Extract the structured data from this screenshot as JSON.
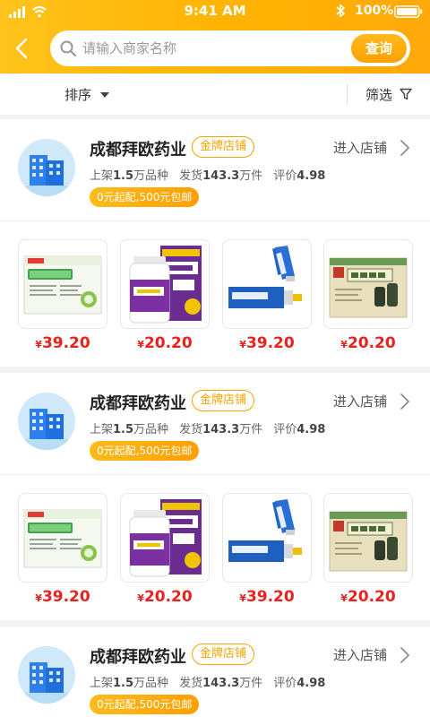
{
  "status_bar": {
    "time": "9:41 AM",
    "battery": "100%"
  },
  "search": {
    "placeholder": "请输入商家名称",
    "button_label": "查询"
  },
  "filter_bar": {
    "sort_label": "排序",
    "filter_label": "筛选"
  },
  "colors": {
    "accent": "#ffb300",
    "price": "#e8221d",
    "badge": "#f5a300"
  },
  "stores": [
    {
      "name": "成都拜欧药业",
      "badge": "金牌店铺",
      "enter_label": "进入店铺",
      "listed_label": "上架",
      "listed_value": "1.5",
      "listed_unit": "万品种",
      "shipped_label": "发货",
      "shipped_value": "143.3",
      "shipped_unit": "万件",
      "rating_label": "评价",
      "rating_value": "4.98",
      "promo": "0元起配,500元包邮",
      "products": [
        {
          "image": "green-granule-box",
          "currency": "¥",
          "price": "39.20"
        },
        {
          "image": "caltrate-bottle-box",
          "currency": "¥",
          "price": "20.20"
        },
        {
          "image": "blue-ointment-tube",
          "currency": "¥",
          "price": "39.20"
        },
        {
          "image": "huoxiang-box",
          "currency": "¥",
          "price": "20.20"
        }
      ]
    },
    {
      "name": "成都拜欧药业",
      "badge": "金牌店铺",
      "enter_label": "进入店铺",
      "listed_label": "上架",
      "listed_value": "1.5",
      "listed_unit": "万品种",
      "shipped_label": "发货",
      "shipped_value": "143.3",
      "shipped_unit": "万件",
      "rating_label": "评价",
      "rating_value": "4.98",
      "promo": "0元起配,500元包邮",
      "products": [
        {
          "image": "green-granule-box",
          "currency": "¥",
          "price": "39.20"
        },
        {
          "image": "caltrate-bottle-box",
          "currency": "¥",
          "price": "20.20"
        },
        {
          "image": "blue-ointment-tube",
          "currency": "¥",
          "price": "39.20"
        },
        {
          "image": "huoxiang-box",
          "currency": "¥",
          "price": "20.20"
        }
      ]
    },
    {
      "name": "成都拜欧药业",
      "badge": "金牌店铺",
      "enter_label": "进入店铺",
      "listed_label": "上架",
      "listed_value": "1.5",
      "listed_unit": "万品种",
      "shipped_label": "发货",
      "shipped_value": "143.3",
      "shipped_unit": "万件",
      "rating_label": "评价",
      "rating_value": "4.98",
      "promo": "0元起配,500元包邮",
      "products": []
    }
  ]
}
